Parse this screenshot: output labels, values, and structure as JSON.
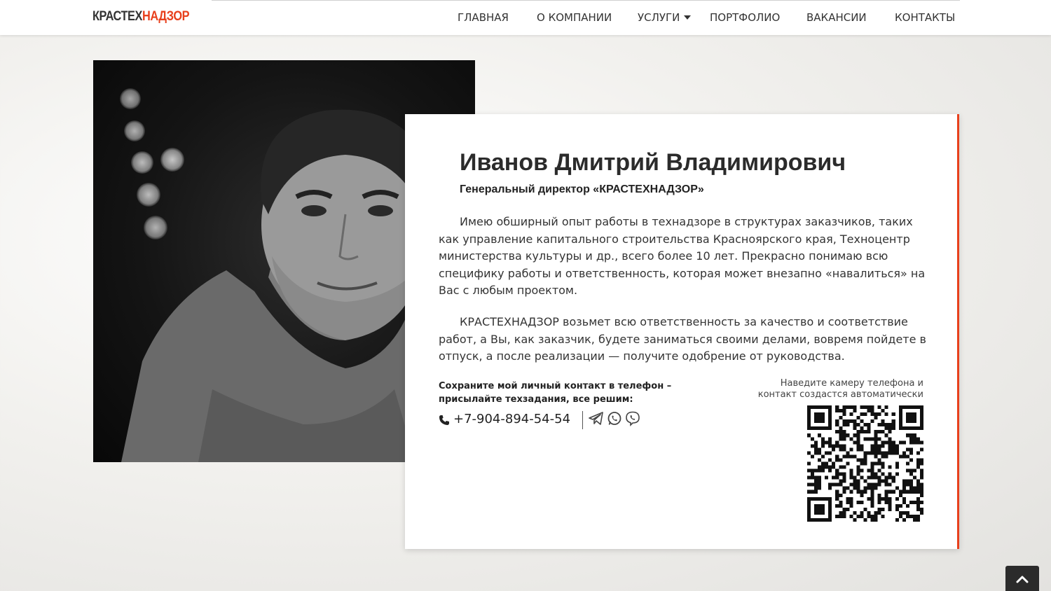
{
  "header": {
    "logo_part1": "КРАСТЕХ",
    "logo_part2": "НАДЗОР",
    "nav": [
      {
        "label": "ГЛАВНАЯ"
      },
      {
        "label": "О КОМПАНИИ"
      },
      {
        "label": "УСЛУГИ"
      },
      {
        "label": "ПОРТФОЛИО"
      },
      {
        "label": "ВАКАНСИИ"
      },
      {
        "label": "КОНТАКТЫ"
      }
    ]
  },
  "profile": {
    "name": "Иванов Дмитрий Владимирович",
    "position": "Генеральный директор «КРАСТЕХНАДЗОР»",
    "paragraphs": [
      "Имею обширный опыт работы в технадзоре в структурах заказчиков, таких как управление капитального строительства Красноярского края, Техноцентр министерства культуры и др., всего более 10 лет. Прекрасно понимаю всю специфику работы и ответственность, которая может внезапно «навалиться» на Вас с любым проектом.",
      "КРАСТЕХНАДЗОР возьмет всю ответственность за качество и соответствие работ, а Вы, как заказчик, будете заниматься своими делами, вовремя пойдете в отпуск, а после реализации — получите одобрение от руководства."
    ],
    "save_contact": "Сохраните мой личный контакт в телефон – присылайте техзадания, все решим:",
    "phone": "+7-904-894-54-54",
    "messengers": [
      "telegram-icon",
      "whatsapp-icon",
      "viber-icon"
    ],
    "qr_hint": "Наведите камеру телефона и контакт создастся автоматически"
  },
  "colors": {
    "accent": "#e8401c",
    "text": "#2b2b2b"
  }
}
